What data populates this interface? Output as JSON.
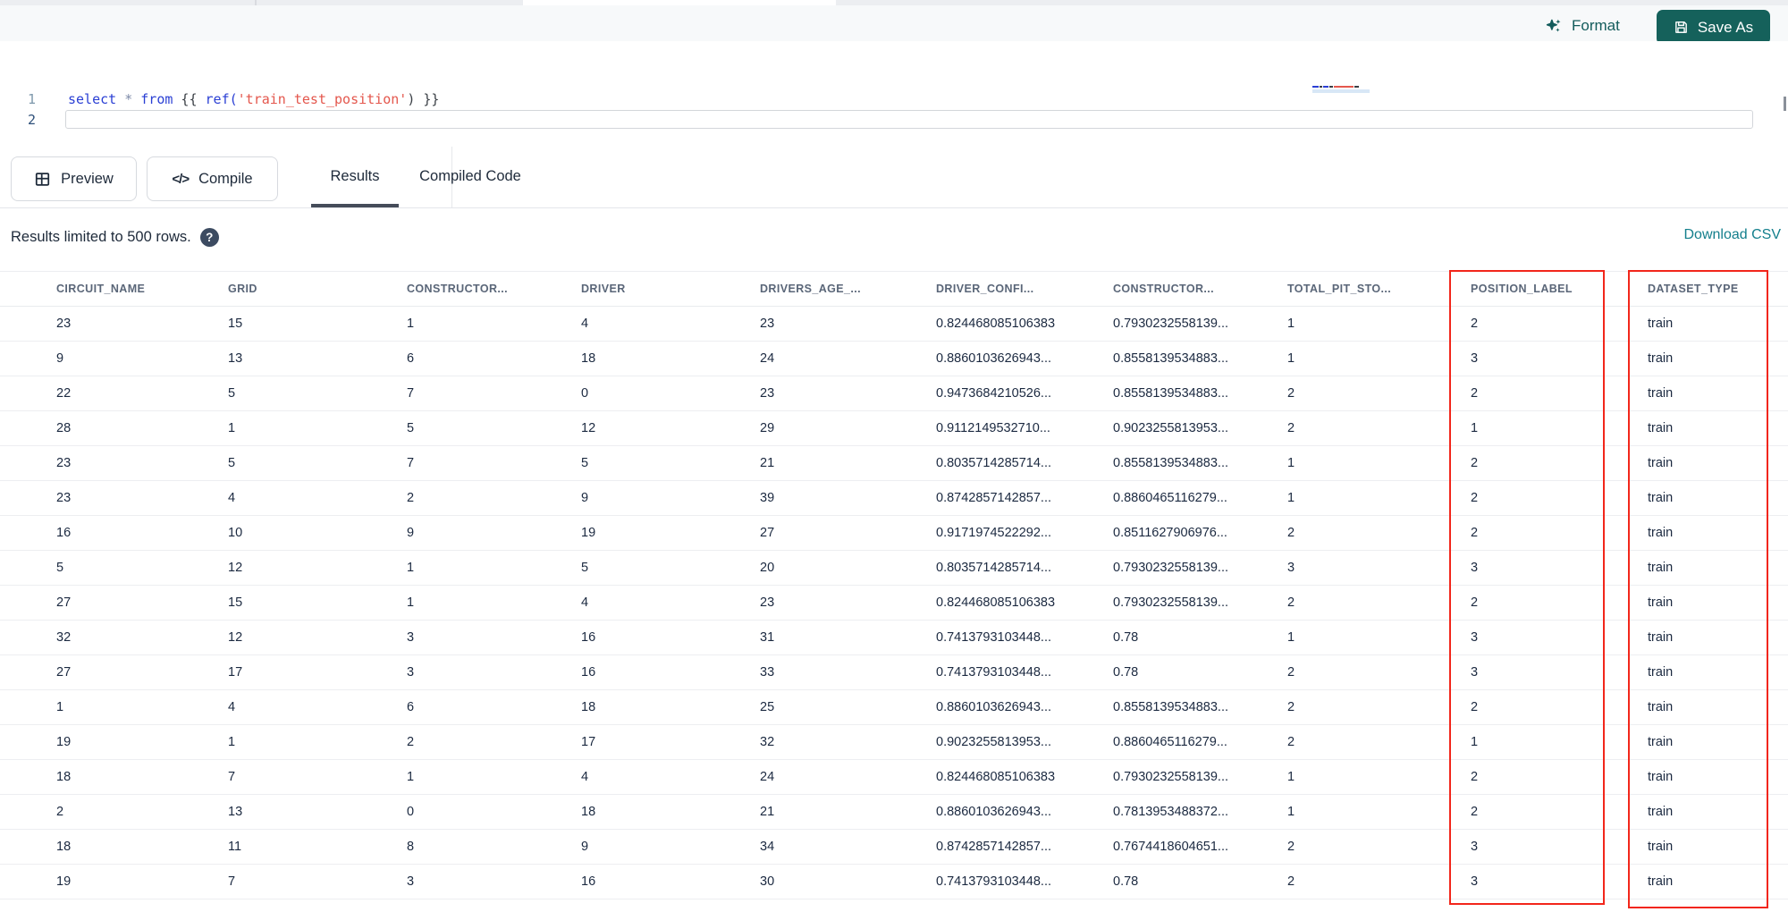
{
  "editor": {
    "lines": [
      {
        "number": "1",
        "tokens": [
          {
            "t": "select",
            "c": "kw"
          },
          {
            "t": " ",
            "c": "plain"
          },
          {
            "t": "*",
            "c": "op"
          },
          {
            "t": " ",
            "c": "plain"
          },
          {
            "t": "from",
            "c": "kw"
          },
          {
            "t": " {{ ",
            "c": "plain"
          },
          {
            "t": "ref(",
            "c": "fn"
          },
          {
            "t": "'train_test_position'",
            "c": "str"
          },
          {
            "t": ") }}",
            "c": "plain"
          }
        ]
      },
      {
        "number": "2",
        "tokens": []
      }
    ]
  },
  "toolbar": {
    "format_label": "Format",
    "save_as_label": "Save As"
  },
  "actions": {
    "preview_label": "Preview",
    "compile_label": "Compile"
  },
  "tabs": [
    {
      "label": "Results",
      "active": true
    },
    {
      "label": "Compiled Code",
      "active": false
    }
  ],
  "status": {
    "text": "Results limited to 500 rows.",
    "download_label": "Download CSV"
  },
  "icons": {
    "format": "sparkles-icon",
    "save_as": "floppy-disk-icon",
    "preview": "table-grid-icon",
    "compile_glyph": "</>",
    "help_glyph": "?"
  },
  "table": {
    "columns": [
      "CIRCUIT_NAME",
      "GRID",
      "CONSTRUCTOR...",
      "DRIVER",
      "DRIVERS_AGE_...",
      "DRIVER_CONFI...",
      "CONSTRUCTOR...",
      "TOTAL_PIT_STO...",
      "POSITION_LABEL",
      "DATASET_TYPE"
    ],
    "rows": [
      [
        "23",
        "15",
        "1",
        "4",
        "23",
        "0.824468085106383",
        "0.7930232558139...",
        "1",
        "2",
        "train"
      ],
      [
        "9",
        "13",
        "6",
        "18",
        "24",
        "0.8860103626943...",
        "0.8558139534883...",
        "1",
        "3",
        "train"
      ],
      [
        "22",
        "5",
        "7",
        "0",
        "23",
        "0.9473684210526...",
        "0.8558139534883...",
        "2",
        "2",
        "train"
      ],
      [
        "28",
        "1",
        "5",
        "12",
        "29",
        "0.9112149532710...",
        "0.9023255813953...",
        "2",
        "1",
        "train"
      ],
      [
        "23",
        "5",
        "7",
        "5",
        "21",
        "0.8035714285714...",
        "0.8558139534883...",
        "1",
        "2",
        "train"
      ],
      [
        "23",
        "4",
        "2",
        "9",
        "39",
        "0.8742857142857...",
        "0.8860465116279...",
        "1",
        "2",
        "train"
      ],
      [
        "16",
        "10",
        "9",
        "19",
        "27",
        "0.9171974522292...",
        "0.8511627906976...",
        "2",
        "2",
        "train"
      ],
      [
        "5",
        "12",
        "1",
        "5",
        "20",
        "0.8035714285714...",
        "0.7930232558139...",
        "3",
        "3",
        "train"
      ],
      [
        "27",
        "15",
        "1",
        "4",
        "23",
        "0.824468085106383",
        "0.7930232558139...",
        "2",
        "2",
        "train"
      ],
      [
        "32",
        "12",
        "3",
        "16",
        "31",
        "0.7413793103448...",
        "0.78",
        "1",
        "3",
        "train"
      ],
      [
        "27",
        "17",
        "3",
        "16",
        "33",
        "0.7413793103448...",
        "0.78",
        "2",
        "3",
        "train"
      ],
      [
        "1",
        "4",
        "6",
        "18",
        "25",
        "0.8860103626943...",
        "0.8558139534883...",
        "2",
        "2",
        "train"
      ],
      [
        "19",
        "1",
        "2",
        "17",
        "32",
        "0.9023255813953...",
        "0.8860465116279...",
        "2",
        "1",
        "train"
      ],
      [
        "18",
        "7",
        "1",
        "4",
        "24",
        "0.824468085106383",
        "0.7930232558139...",
        "1",
        "2",
        "train"
      ],
      [
        "2",
        "13",
        "0",
        "18",
        "21",
        "0.8860103626943...",
        "0.7813953488372...",
        "1",
        "2",
        "train"
      ],
      [
        "18",
        "11",
        "8",
        "9",
        "34",
        "0.8742857142857...",
        "0.7674418604651...",
        "2",
        "3",
        "train"
      ],
      [
        "19",
        "7",
        "3",
        "16",
        "30",
        "0.7413793103448...",
        "0.78",
        "2",
        "3",
        "train"
      ]
    ],
    "highlighted_columns": [
      "POSITION_LABEL",
      "DATASET_TYPE"
    ]
  },
  "colors": {
    "accent_teal": "#15615B",
    "link_teal": "#137F8C",
    "annotation_red": "#F2261B",
    "keyword_blue": "#2A3FD4",
    "string_red": "#E4574D",
    "header_gray": "#5A6678",
    "text_dark": "#1B2940"
  }
}
